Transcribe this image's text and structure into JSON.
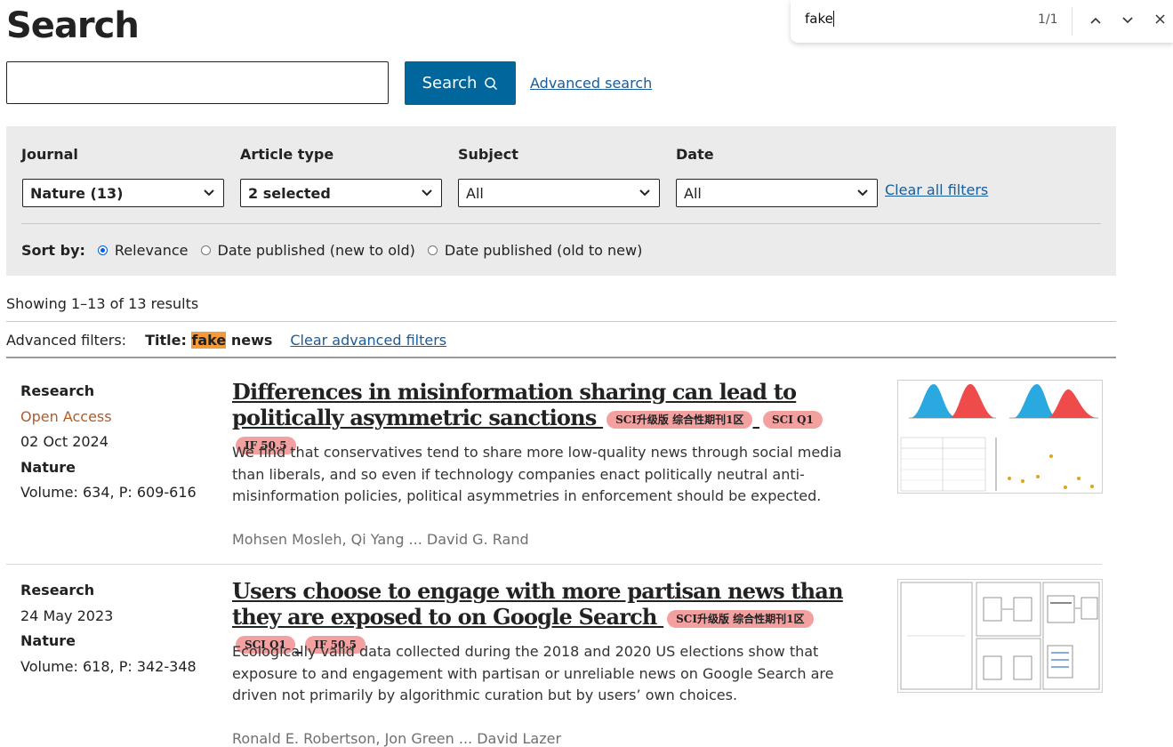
{
  "page_title": "Search",
  "search": {
    "value": "",
    "button_label": "Search",
    "advanced_link": "Advanced search"
  },
  "filters": {
    "journal": {
      "label": "Journal",
      "value": "Nature (13)"
    },
    "article_type": {
      "label": "Article type",
      "value": "2 selected"
    },
    "subject": {
      "label": "Subject",
      "value": "All"
    },
    "date": {
      "label": "Date",
      "value": "All"
    },
    "clear_all": "Clear all filters",
    "sort_label": "Sort by:",
    "sort_options": [
      "Relevance",
      "Date published (new to old)",
      "Date published (old to new)"
    ],
    "sort_selected": "Relevance"
  },
  "results_count": "Showing 1–13 of 13 results",
  "advanced_filters": {
    "label": "Advanced filters:",
    "title_prefix": "Title:",
    "highlight": "fake",
    "rest": "news",
    "clear": "Clear advanced filters"
  },
  "results": [
    {
      "type": "Research",
      "access": "Open Access",
      "date": "02 Oct 2024",
      "journal": "Nature",
      "volume": "Volume: 634, P: 609-616",
      "title": "Differences in misinformation sharing can lead to politically asymmetric sanctions",
      "badges": [
        "SCI升级版 综合性期刊1区",
        "SCI Q1",
        "IF 50.5"
      ],
      "description": "We find that conservatives tend to share more low-quality news through social media than liberals, and so even if technology companies enact politically neutral anti-misinformation policies, political asymmetries in enforcement should be expected.",
      "authors": "Mohsen Mosleh, Qi Yang ... David G. Rand"
    },
    {
      "type": "Research",
      "date": "24 May 2023",
      "journal": "Nature",
      "volume": "Volume: 618, P: 342-348",
      "title": "Users choose to engage with more partisan news than they are exposed to on Google Search",
      "badges": [
        "SCI升级版 综合性期刊1区",
        "SCI Q1",
        "IF 50.5"
      ],
      "description": "Ecologically valid data collected during the 2018 and 2020 US elections show that exposure to and engagement with partisan or unreliable news on Google Search are driven not primarily by algorithmic curation but by users’ own choices.",
      "authors": "Ronald E. Robertson, Jon Green ... David Lazer"
    }
  ],
  "find_bar": {
    "query": "fake",
    "count": "1/1"
  },
  "colors": {
    "accent": "#01669b",
    "link": "#1a5c99",
    "highlight": "#f39a3b",
    "badge": "#f3a0a0",
    "open_access": "#b35a28",
    "panel": "#ebebeb"
  }
}
